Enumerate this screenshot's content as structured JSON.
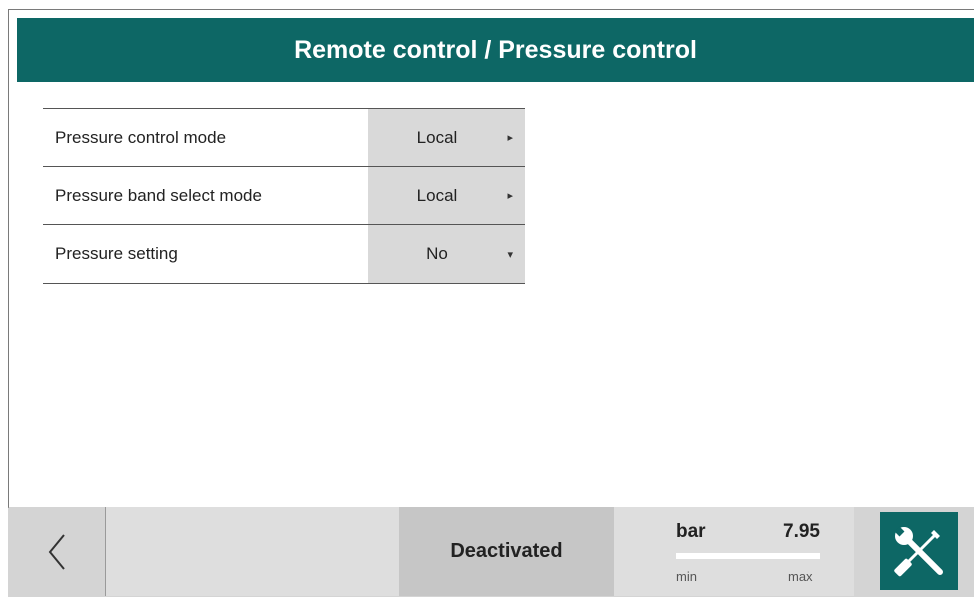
{
  "header": {
    "title": "Remote control / Pressure control"
  },
  "settings": [
    {
      "label": "Pressure control mode",
      "value": "Local",
      "arrow": "right"
    },
    {
      "label": "Pressure band select mode",
      "value": "Local",
      "arrow": "right"
    },
    {
      "label": "Pressure setting",
      "value": "No",
      "arrow": "down"
    }
  ],
  "footer": {
    "status": "Deactivated",
    "gauge": {
      "unit": "bar",
      "value": "7.95",
      "min_label": "min",
      "max_label": "max"
    }
  },
  "icons": {
    "back": "chevron-left-icon",
    "tools": "wrench-screwdriver-icon"
  },
  "colors": {
    "accent": "#0d6765",
    "value_bg": "#d9d9d9",
    "footer_bg": "#d4d4d4"
  }
}
